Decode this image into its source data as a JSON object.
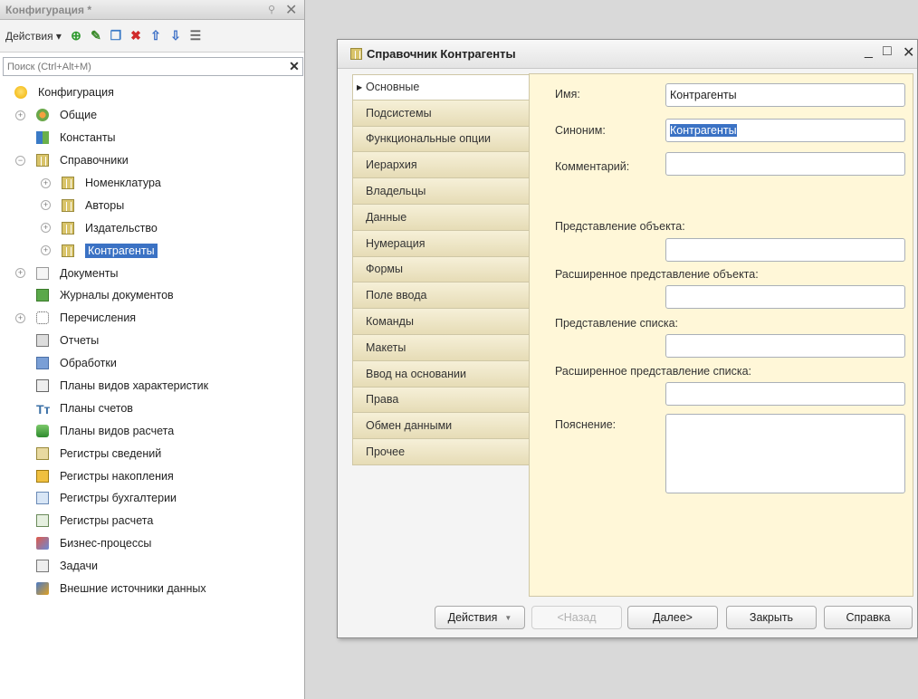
{
  "config_panel": {
    "title": "Конфигурация *",
    "pin_icon": "pin-icon",
    "close_icon": "close-icon",
    "toolbar": {
      "actions_label": "Действия ▾",
      "icons": [
        "add-icon",
        "edit-icon",
        "copy-icon",
        "delete-icon",
        "move-up-icon",
        "move-down-icon",
        "list-icon"
      ]
    },
    "search": {
      "placeholder": "Поиск (Ctrl+Alt+M)",
      "value": ""
    },
    "tree": [
      {
        "label": "Конфигурация",
        "icon": "configuration-icon",
        "expand": ""
      },
      {
        "label": "Общие",
        "icon": "common-icon",
        "expand": "+"
      },
      {
        "label": "Константы",
        "icon": "constants-icon",
        "expand": ""
      },
      {
        "label": "Справочники",
        "icon": "catalog-icon",
        "expand": "−"
      },
      {
        "label": "Номенклатура",
        "icon": "catalog-icon",
        "expand": "+"
      },
      {
        "label": "Авторы",
        "icon": "catalog-icon",
        "expand": "+"
      },
      {
        "label": "Издательство",
        "icon": "catalog-icon",
        "expand": "+"
      },
      {
        "label": "Контрагенты",
        "icon": "catalog-icon",
        "expand": "+",
        "selected": true
      },
      {
        "label": "Документы",
        "icon": "document-icon",
        "expand": "+"
      },
      {
        "label": "Журналы документов",
        "icon": "journal-icon",
        "expand": ""
      },
      {
        "label": "Перечисления",
        "icon": "enum-icon",
        "expand": "+"
      },
      {
        "label": "Отчеты",
        "icon": "report-icon",
        "expand": ""
      },
      {
        "label": "Обработки",
        "icon": "processing-icon",
        "expand": ""
      },
      {
        "label": "Планы видов характеристик",
        "icon": "characteristic-types-icon",
        "expand": ""
      },
      {
        "label": "Планы счетов",
        "icon": "chart-of-accounts-icon",
        "expand": ""
      },
      {
        "label": "Планы видов расчета",
        "icon": "calculation-types-icon",
        "expand": ""
      },
      {
        "label": "Регистры сведений",
        "icon": "info-register-icon",
        "expand": ""
      },
      {
        "label": "Регистры накопления",
        "icon": "accumulation-register-icon",
        "expand": ""
      },
      {
        "label": "Регистры бухгалтерии",
        "icon": "accounting-register-icon",
        "expand": ""
      },
      {
        "label": "Регистры расчета",
        "icon": "calculation-register-icon",
        "expand": ""
      },
      {
        "label": "Бизнес-процессы",
        "icon": "business-process-icon",
        "expand": ""
      },
      {
        "label": "Задачи",
        "icon": "task-icon",
        "expand": ""
      },
      {
        "label": "Внешние источники данных",
        "icon": "external-source-icon",
        "expand": ""
      }
    ]
  },
  "dialog": {
    "title": "Справочник Контрагенты",
    "tabs": [
      "Основные",
      "Подсистемы",
      "Функциональные опции",
      "Иерархия",
      "Владельцы",
      "Данные",
      "Нумерация",
      "Формы",
      "Поле ввода",
      "Команды",
      "Макеты",
      "Ввод на основании",
      "Права",
      "Обмен данными",
      "Прочее"
    ],
    "fields": {
      "name_label": "Имя:",
      "name_value": "Контрагенты",
      "synonym_label": "Синоним:",
      "synonym_value": "Контрагенты",
      "comment_label": "Комментарий:",
      "comment_value": "",
      "object_repr_label": "Представление объекта:",
      "object_repr_value": "",
      "ext_object_repr_label": "Расширенное представление объекта:",
      "ext_object_repr_value": "",
      "list_repr_label": "Представление списка:",
      "list_repr_value": "",
      "ext_list_repr_label": "Расширенное представление списка:",
      "ext_list_repr_value": "",
      "explanation_label": "Пояснение:",
      "explanation_value": ""
    },
    "buttons": {
      "actions": "Действия",
      "back": "<Назад",
      "next": "Далее>",
      "close": "Закрыть",
      "help": "Справка"
    }
  }
}
